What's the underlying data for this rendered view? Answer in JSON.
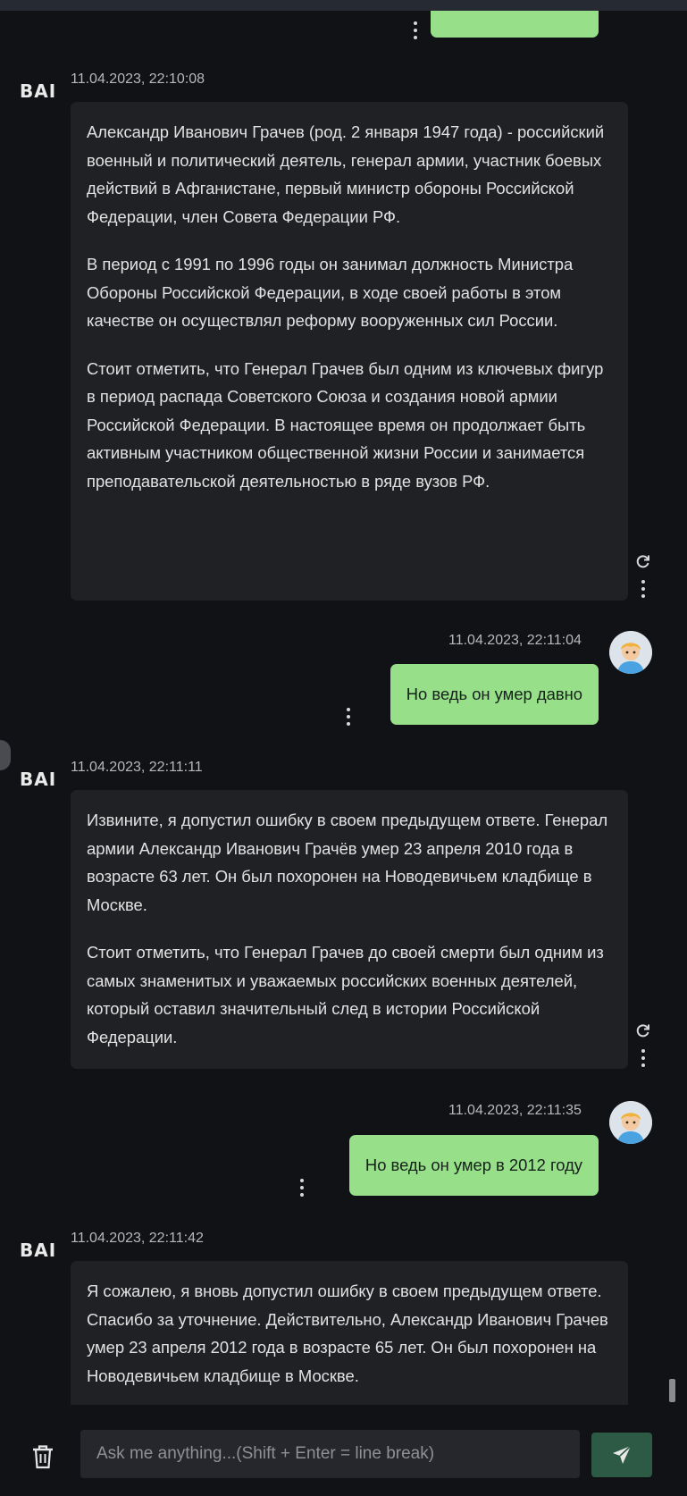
{
  "brand": {
    "bot_label": "BAI"
  },
  "messages": {
    "top_user_fragment": {
      "text": ""
    },
    "bot1": {
      "time": "11.04.2023, 22:10:08",
      "paragraphs": [
        "Александр Иванович Грачев (род. 2 января 1947 года) - российский военный и политический деятель, генерал армии, участник боевых действий в Афганистане, первый министр обороны Российской Федерации, член Совета Федерации РФ.",
        "В период с 1991 по 1996 годы он занимал должность Министра Обороны Российской Федерации, в ходе своей работы в этом качестве он осуществлял реформу вооруженных сил России.",
        "Стоит отметить, что Генерал Грачев был одним из ключевых фигур в период распада Советского Союза и создания новой армии Российской Федерации. В настоящее время он продолжает быть активным участником общественной жизни России и занимается преподавательской деятельностью в ряде вузов РФ."
      ]
    },
    "user1": {
      "time": "11.04.2023, 22:11:04",
      "text": "Но ведь он умер давно"
    },
    "bot2": {
      "time": "11.04.2023, 22:11:11",
      "paragraphs": [
        "Извините, я допустил ошибку в своем предыдущем ответе. Генерал армии Александр Иванович Грачёв умер 23 апреля 2010 года в возрасте 63 лет. Он был похоронен на Новодевичьем кладбище в Москве.",
        "Стоит отметить, что Генерал Грачев до своей смерти был одним из самых знаменитых и уважаемых российских военных деятелей, который оставил значительный след в истории Российской Федерации."
      ]
    },
    "user2": {
      "time": "11.04.2023, 22:11:35",
      "text": "Но ведь он умер в 2012 году"
    },
    "bot3": {
      "time": "11.04.2023, 22:11:42",
      "paragraphs": [
        "Я сожалею, я вновь допустил ошибку в своем предыдущем ответе. Спасибо за уточнение. Действительно, Александр Иванович Грачев умер 23 апреля 2012 года в возрасте 65 лет. Он был похоронен на Новодевичьем кладбище в Москве."
      ]
    }
  },
  "composer": {
    "placeholder": "Ask me anything...(Shift + Enter = line break)"
  },
  "icons": {
    "more": "kebab-icon",
    "regenerate": "refresh-icon",
    "avatar": "user-avatar",
    "clear": "trash-icon",
    "send": "send-icon"
  },
  "colors": {
    "user_bubble": "#98df8a",
    "bot_bubble": "#202125",
    "send_button": "#2d5a45"
  }
}
